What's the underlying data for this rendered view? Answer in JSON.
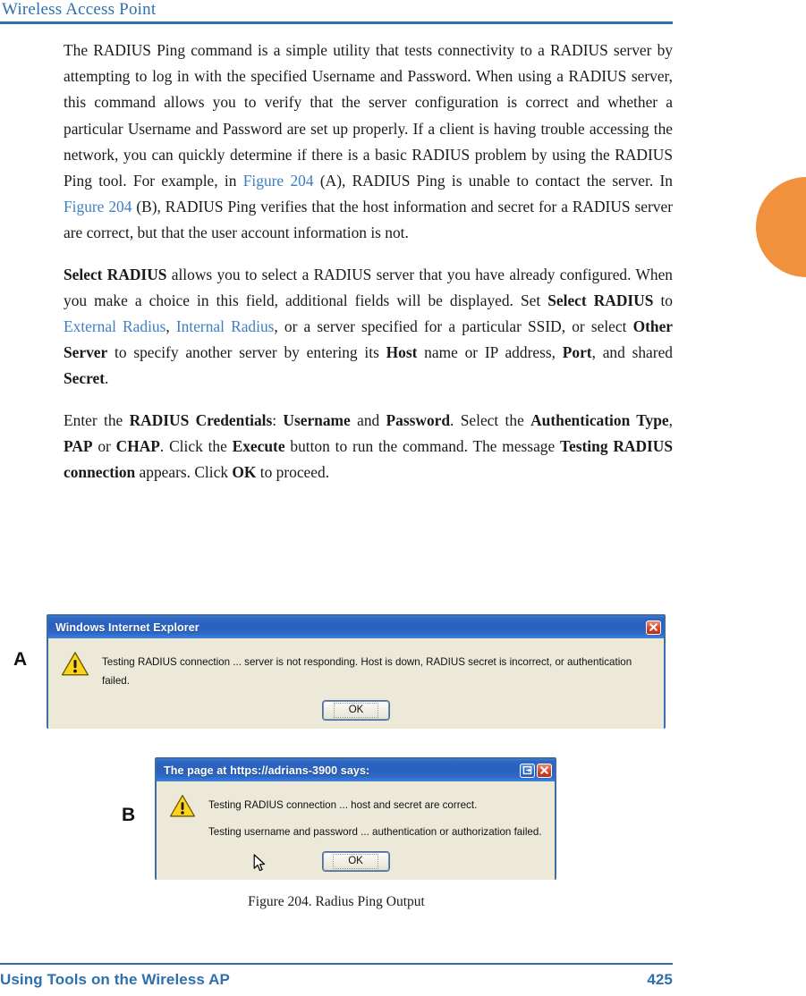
{
  "header": {
    "title": "Wireless Access Point"
  },
  "footer": {
    "section": "Using Tools on the Wireless AP",
    "page_number": "425"
  },
  "accent": {
    "heading_blue": "#2f6fad",
    "link_blue": "#3b7fc4",
    "thumb_tab_orange": "#f2913d",
    "dialog_face": "#ece9d8",
    "titlebar_blue": "#2b60bd",
    "close_red": "#d9442a",
    "warning_yellow": "#ffd31c"
  },
  "paragraphs": {
    "p1": {
      "s1": "The RADIUS Ping command is a simple utility that tests connectivity to a RADIUS server by attempting to log in with the specified Username and Password. When using a RADIUS server, this command allows you to verify that the server configuration is correct and whether a particular Username and Password are set up properly. If a client is having trouble accessing the network, you can quickly determine if there is a basic RADIUS problem by using the RADIUS Ping tool. For example, in ",
      "link1": "Figure 204",
      "s2": " (A), RADIUS Ping is unable to contact the server. In ",
      "link2": "Figure 204",
      "s3": " (B), RADIUS Ping verifies that the host information and secret for a RADIUS server are correct, but that the user account information is not."
    },
    "p2": {
      "b1": "Select RADIUS",
      "s1": " allows you to select a RADIUS server that you have already configured. When you make a choice in this field, additional fields will be displayed. Set ",
      "b2": "Select RADIUS",
      "s2": " to ",
      "link1": "External Radius",
      "s3": ", ",
      "link2": "Internal Radius",
      "s4": ", or a server specified for a particular SSID, or select ",
      "b3": "Other Server",
      "s5": " to specify another server by entering its ",
      "b4": "Host",
      "s6": " name or IP address, ",
      "b5": "Port",
      "s7": ", and shared ",
      "b6": "Secret",
      "s8": "."
    },
    "p3": {
      "s1": "Enter the ",
      "b1": "RADIUS Credentials",
      "s2": ": ",
      "b2": "Username",
      "s3": " and ",
      "b3": "Password",
      "s4": ". Select the ",
      "b4": "Authentication Type",
      "s5": ", ",
      "b5": "PAP",
      "s6": " or ",
      "b6": "CHAP",
      "s7": ". Click the ",
      "b7": "Execute",
      "s8": " button to run the command. The message ",
      "b8": "Testing RADIUS connection",
      "s9": " appears. Click ",
      "b9": "OK",
      "s10": " to proceed."
    }
  },
  "figure": {
    "caption": "Figure 204. Radius Ping Output",
    "label_a": "A",
    "label_b": "B",
    "dialog_a": {
      "title": "Windows Internet Explorer",
      "message_lines": [
        "Testing RADIUS connection ... server is not responding. Host is down, RADIUS secret is incorrect, or authentication failed."
      ],
      "ok_label": "OK",
      "icon": "warning-triangle-icon",
      "close_label": "x"
    },
    "dialog_b": {
      "title": "The page at https://adrians-3900 says:",
      "message_lines": [
        "Testing RADIUS connection ... host and secret are correct.",
        "Testing username and password ... authentication or authorization failed."
      ],
      "ok_label": "OK",
      "icon": "warning-triangle-icon",
      "restore_label": "restore",
      "close_label": "x"
    }
  }
}
